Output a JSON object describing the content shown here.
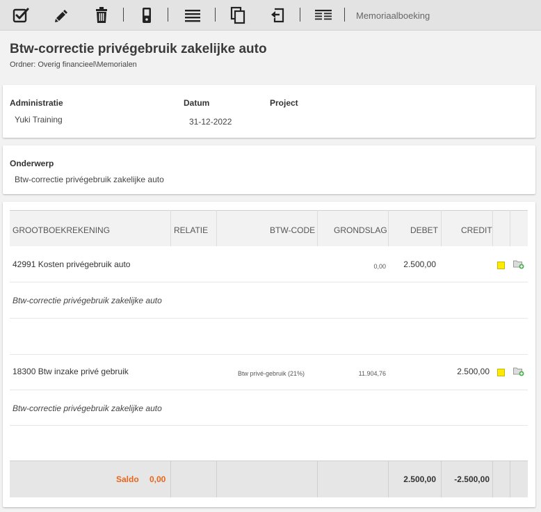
{
  "toolbar": {
    "items": [
      {
        "icon": "checkbox-check-icon"
      },
      {
        "icon": "pencil-icon"
      },
      {
        "icon": "trash-icon"
      },
      {
        "icon": "phone-icon"
      },
      {
        "icon": "list-lines-icon"
      },
      {
        "icon": "copy-icon"
      },
      {
        "icon": "reverse-icon"
      },
      {
        "icon": "text-columns-icon"
      }
    ],
    "label": "Memoriaalboeking"
  },
  "header": {
    "title": "Btw-correctie privégebruik zakelijke auto",
    "folder": "Ordner: Overig financieel\\Memorialen"
  },
  "info": {
    "administratie_label": "Administratie",
    "administratie_value": "Yuki Training",
    "datum_label": "Datum",
    "datum_value": "31-12-2022",
    "project_label": "Project",
    "project_value": ""
  },
  "subject": {
    "label": "Onderwerp",
    "value": "Btw-correctie privégebruik zakelijke auto"
  },
  "table": {
    "headers": {
      "grootboek": "GROOTBOEKREKENING",
      "relatie": "RELATIE",
      "btwcode": "BTW-CODE",
      "grondslag": "GRONDSLAG",
      "debet": "DEBET",
      "credit": "CREDIT"
    },
    "rows": [
      {
        "account": "42991 Kosten privégebruik auto",
        "btwcode": "",
        "grondslag": "0,00",
        "debet": "2.500,00",
        "credit": "",
        "description": "Btw-correctie privégebruik zakelijke auto"
      },
      {
        "account": "18300 Btw inzake privé gebruik",
        "btwcode": "Btw privé-gebruik (21%)",
        "grondslag": "11.904,76",
        "debet": "",
        "credit": "2.500,00",
        "description": "Btw-correctie privégebruik zakelijke auto"
      }
    ],
    "footer": {
      "saldo_label": "Saldo",
      "saldo_value": "0,00",
      "debet_total": "2.500,00",
      "credit_total": "-2.500,00"
    }
  },
  "colors": {
    "saldo": "#e8651a",
    "flag": "#ffea00",
    "toolbar_bg": "#e3e3e3"
  }
}
